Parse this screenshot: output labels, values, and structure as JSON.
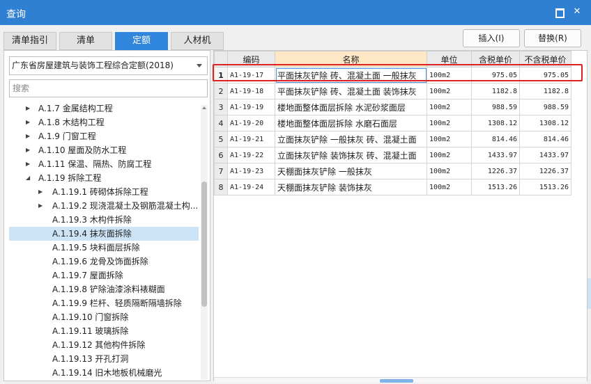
{
  "window": {
    "title": "查询",
    "maximize_icon": "maximize-icon",
    "close_icon": "close-icon",
    "close_glyph": "✕"
  },
  "tabs": [
    {
      "label": "清单指引",
      "active": false
    },
    {
      "label": "清单",
      "active": false
    },
    {
      "label": "定额",
      "active": true
    },
    {
      "label": "人材机",
      "active": false
    }
  ],
  "buttons": {
    "insert": "插入(I)",
    "replace": "替换(R)"
  },
  "left": {
    "selected_norm": "广东省房屋建筑与装饰工程综合定额(2018)",
    "search_placeholder": "搜索",
    "tree": [
      {
        "label": "A.1.7 金属结构工程",
        "level": 1,
        "arrow": "▶",
        "selected": false
      },
      {
        "label": "A.1.8 木结构工程",
        "level": 1,
        "arrow": "▶",
        "selected": false
      },
      {
        "label": "A.1.9 门窗工程",
        "level": 1,
        "arrow": "▶",
        "selected": false
      },
      {
        "label": "A.1.10 屋面及防水工程",
        "level": 1,
        "arrow": "▶",
        "selected": false
      },
      {
        "label": "A.1.11 保温、隔热、防腐工程",
        "level": 1,
        "arrow": "▶",
        "selected": false
      },
      {
        "label": "A.1.19 拆除工程",
        "level": 1,
        "arrow": "◢",
        "selected": false
      },
      {
        "label": "A.1.19.1 砖砌体拆除工程",
        "level": 2,
        "arrow": "▶",
        "selected": false
      },
      {
        "label": "A.1.19.2 现浇混凝土及钢筋混凝土构...",
        "level": 2,
        "arrow": "▶",
        "selected": false
      },
      {
        "label": "A.1.19.3 木构件拆除",
        "level": 2,
        "arrow": "",
        "selected": false
      },
      {
        "label": "A.1.19.4 抹灰面拆除",
        "level": 2,
        "arrow": "",
        "selected": true
      },
      {
        "label": "A.1.19.5 块料面层拆除",
        "level": 2,
        "arrow": "",
        "selected": false
      },
      {
        "label": "A.1.19.6 龙骨及饰面拆除",
        "level": 2,
        "arrow": "",
        "selected": false
      },
      {
        "label": "A.1.19.7 屋面拆除",
        "level": 2,
        "arrow": "",
        "selected": false
      },
      {
        "label": "A.1.19.8 铲除油漆涂料裱糊面",
        "level": 2,
        "arrow": "",
        "selected": false
      },
      {
        "label": "A.1.19.9 栏杆、轻质隔断隔墙拆除",
        "level": 2,
        "arrow": "",
        "selected": false
      },
      {
        "label": "A.1.19.10 门窗拆除",
        "level": 2,
        "arrow": "",
        "selected": false
      },
      {
        "label": "A.1.19.11 玻璃拆除",
        "level": 2,
        "arrow": "",
        "selected": false
      },
      {
        "label": "A.1.19.12 其他构件拆除",
        "level": 2,
        "arrow": "",
        "selected": false
      },
      {
        "label": "A.1.19.13 开孔打洞",
        "level": 2,
        "arrow": "",
        "selected": false
      },
      {
        "label": "A.1.19.14 旧木地板机械磨光",
        "level": 2,
        "arrow": "",
        "selected": false
      }
    ]
  },
  "table": {
    "columns": [
      "编码",
      "名称",
      "单位",
      "含税单价",
      "不含税单价"
    ],
    "rows": [
      {
        "index": "1",
        "code": "A1-19-17",
        "name": "平面抹灰铲除 砖、混凝土面 一般抹灰",
        "unit": "100m2",
        "tax_price": "975.05",
        "notax_price": "975.05"
      },
      {
        "index": "2",
        "code": "A1-19-18",
        "name": "平面抹灰铲除 砖、混凝土面 装饰抹灰",
        "unit": "100m2",
        "tax_price": "1182.8",
        "notax_price": "1182.8"
      },
      {
        "index": "3",
        "code": "A1-19-19",
        "name": "楼地面整体面层拆除 水泥砂浆面层",
        "unit": "100m2",
        "tax_price": "988.59",
        "notax_price": "988.59"
      },
      {
        "index": "4",
        "code": "A1-19-20",
        "name": "楼地面整体面层拆除 水磨石面层",
        "unit": "100m2",
        "tax_price": "1308.12",
        "notax_price": "1308.12"
      },
      {
        "index": "5",
        "code": "A1-19-21",
        "name": "立面抹灰铲除 一般抹灰 砖、混凝土面",
        "unit": "100m2",
        "tax_price": "814.46",
        "notax_price": "814.46"
      },
      {
        "index": "6",
        "code": "A1-19-22",
        "name": "立面抹灰铲除 装饰抹灰 砖、混凝土面",
        "unit": "100m2",
        "tax_price": "1433.97",
        "notax_price": "1433.97"
      },
      {
        "index": "7",
        "code": "A1-19-23",
        "name": "天棚面抹灰铲除 一般抹灰",
        "unit": "100m2",
        "tax_price": "1226.37",
        "notax_price": "1226.37"
      },
      {
        "index": "8",
        "code": "A1-19-24",
        "name": "天棚面抹灰铲除 装饰抹灰",
        "unit": "100m2",
        "tax_price": "1513.26",
        "notax_price": "1513.26"
      }
    ]
  },
  "colors": {
    "titlebar": "#2f7fd2",
    "active_tab": "#2f86dc",
    "highlight": "#e02020",
    "selected_tree": "#cde4f7",
    "name_header": "#fde7c5"
  }
}
